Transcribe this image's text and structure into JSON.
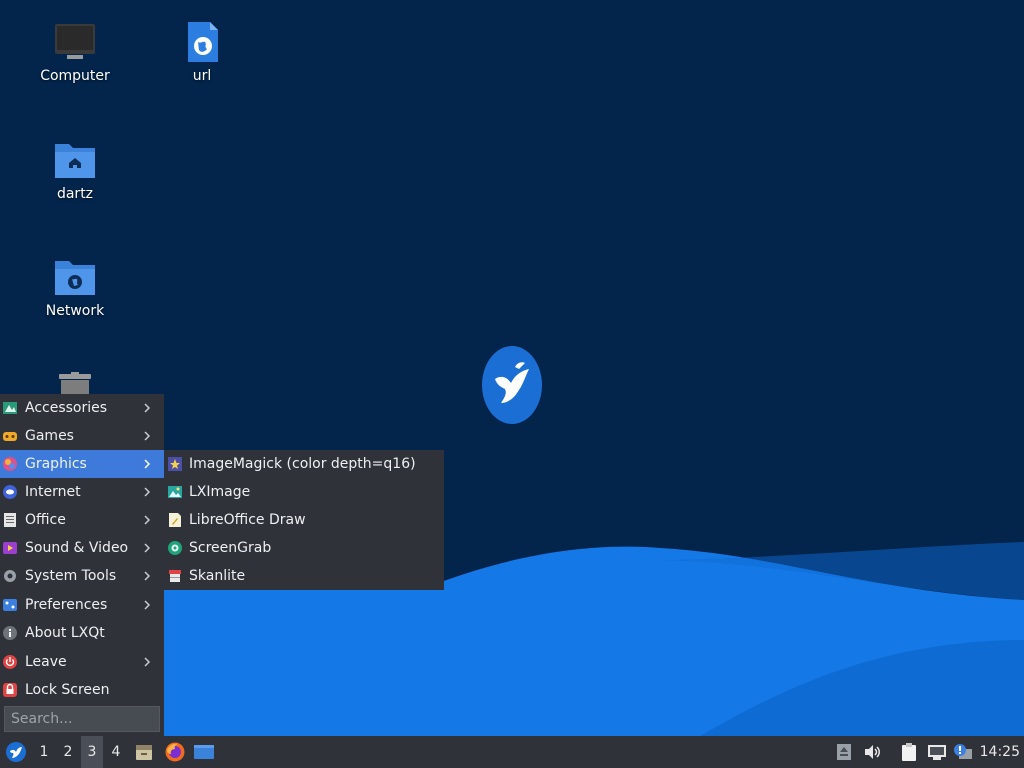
{
  "colors": {
    "desktop_bg": "#03244b",
    "wave_light": "#1479e6",
    "wave_dark": "#0a62c6",
    "menu_bg": "#2f3238",
    "menu_highlight": "#3d7ad9",
    "taskbar_bg": "#2f3238"
  },
  "desktop": {
    "icons": [
      {
        "label": "Computer",
        "icon": "monitor-icon"
      },
      {
        "label": "url",
        "icon": "web-link-icon"
      },
      {
        "label": "dartz",
        "icon": "home-folder-icon"
      },
      {
        "label": "Network",
        "icon": "network-folder-icon"
      },
      {
        "label": "",
        "icon": "trash-icon"
      }
    ],
    "center_logo": "lxqt-bird-logo"
  },
  "menu": {
    "items": [
      {
        "label": "Accessories",
        "icon": "accessories-icon",
        "submenu": true
      },
      {
        "label": "Games",
        "icon": "games-icon",
        "submenu": true
      },
      {
        "label": "Graphics",
        "icon": "graphics-icon",
        "submenu": true,
        "active": true
      },
      {
        "label": "Internet",
        "icon": "internet-icon",
        "submenu": true
      },
      {
        "label": "Office",
        "icon": "office-icon",
        "submenu": true
      },
      {
        "label": "Sound & Video",
        "icon": "sound-video-icon",
        "submenu": true
      },
      {
        "label": "System Tools",
        "icon": "system-tools-icon",
        "submenu": true
      },
      {
        "label": "Preferences",
        "icon": "preferences-icon",
        "submenu": true
      },
      {
        "label": "About LXQt",
        "icon": "info-icon",
        "submenu": false
      },
      {
        "label": "Leave",
        "icon": "power-icon",
        "submenu": true
      },
      {
        "label": "Lock Screen",
        "icon": "lock-icon",
        "submenu": false
      }
    ],
    "search": {
      "placeholder": "Search..."
    }
  },
  "submenu": {
    "parent": "Graphics",
    "items": [
      {
        "label": "ImageMagick (color depth=q16)",
        "icon": "imagemagick-icon"
      },
      {
        "label": "LXImage",
        "icon": "lximage-icon"
      },
      {
        "label": "LibreOffice Draw",
        "icon": "libreoffice-draw-icon"
      },
      {
        "label": "ScreenGrab",
        "icon": "screengrab-icon"
      },
      {
        "label": "Skanlite",
        "icon": "skanlite-icon"
      }
    ]
  },
  "taskbar": {
    "start_icon": "lxqt-start-icon",
    "workspaces": [
      "1",
      "2",
      "3",
      "4"
    ],
    "current_workspace": "3",
    "quicklaunch": [
      "file-manager-icon",
      "firefox-icon",
      "show-desktop-icon"
    ],
    "tray": [
      "removable-media-icon",
      "volume-icon",
      "clipboard-icon",
      "network-icon",
      "update-notifier-icon"
    ],
    "clock": "14:25"
  }
}
